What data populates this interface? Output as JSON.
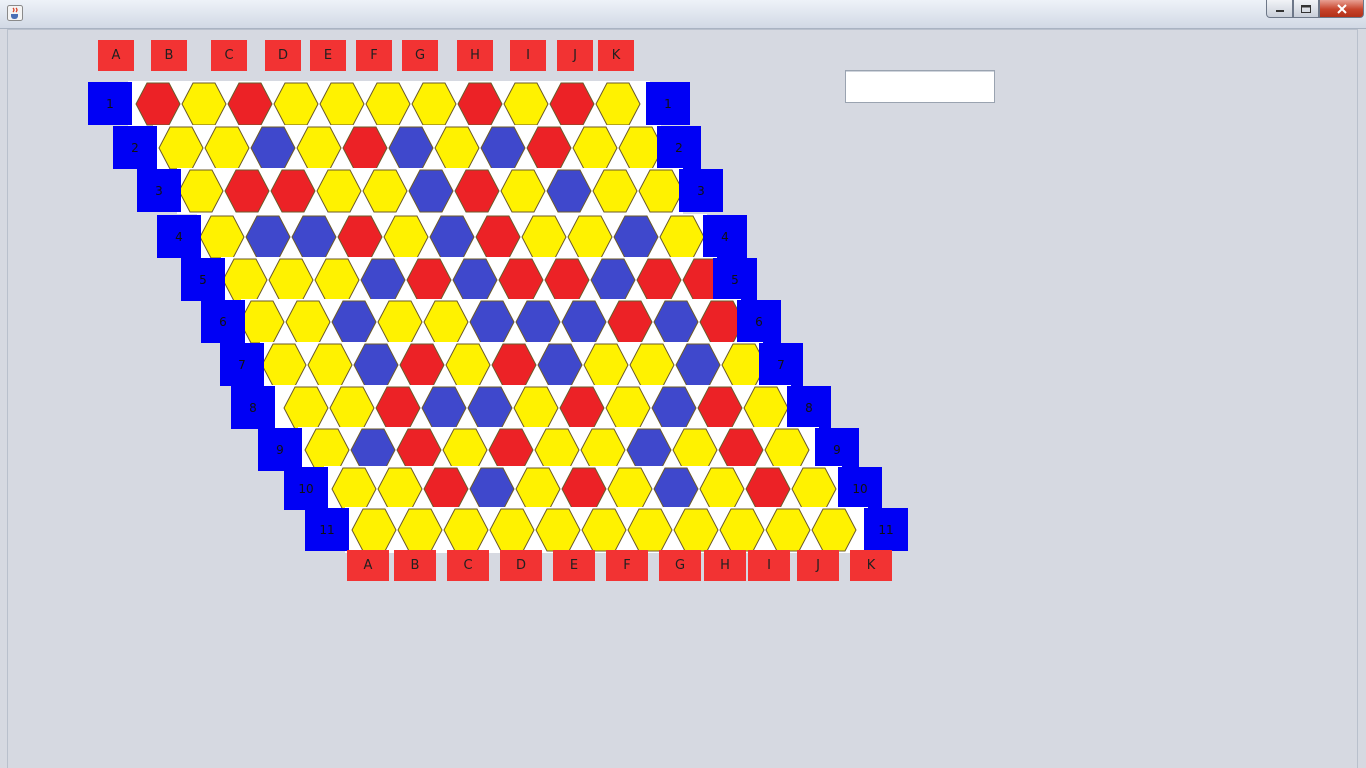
{
  "window": {
    "title": "",
    "icon": "java-coffee-icon",
    "controls": [
      "minimize-icon",
      "maximize-icon",
      "close-icon"
    ]
  },
  "colors": {
    "background": "#d6d9e1",
    "red": "#ec2226",
    "yellow": "#fff200",
    "blue": "#3f48cc",
    "border_blue": "#0000f5",
    "label_red": "#f23333"
  },
  "status_field": {
    "value": ""
  },
  "board": {
    "columns": [
      "A",
      "B",
      "C",
      "D",
      "E",
      "F",
      "G",
      "H",
      "I",
      "J",
      "K"
    ],
    "rows": [
      "1",
      "2",
      "3",
      "4",
      "5",
      "6",
      "7",
      "8",
      "9",
      "10",
      "11"
    ],
    "cells": [
      [
        "R",
        "Y",
        "R",
        "Y",
        "Y",
        "Y",
        "Y",
        "R",
        "Y",
        "R",
        "Y"
      ],
      [
        "Y",
        "Y",
        "B",
        "Y",
        "R",
        "B",
        "Y",
        "B",
        "R",
        "Y",
        "Y"
      ],
      [
        "Y",
        "R",
        "R",
        "Y",
        "Y",
        "B",
        "R",
        "Y",
        "B",
        "Y",
        "Y"
      ],
      [
        "Y",
        "B",
        "B",
        "R",
        "Y",
        "B",
        "R",
        "Y",
        "Y",
        "B",
        "Y"
      ],
      [
        "Y",
        "Y",
        "Y",
        "B",
        "R",
        "B",
        "R",
        "R",
        "B",
        "R",
        "R"
      ],
      [
        "Y",
        "Y",
        "B",
        "Y",
        "Y",
        "B",
        "B",
        "B",
        "R",
        "B",
        "R"
      ],
      [
        "Y",
        "Y",
        "B",
        "R",
        "Y",
        "R",
        "B",
        "Y",
        "Y",
        "B",
        "Y"
      ],
      [
        "Y",
        "Y",
        "R",
        "B",
        "B",
        "Y",
        "R",
        "Y",
        "B",
        "R",
        "Y"
      ],
      [
        "Y",
        "B",
        "R",
        "Y",
        "R",
        "Y",
        "Y",
        "B",
        "Y",
        "R",
        "Y"
      ],
      [
        "Y",
        "Y",
        "R",
        "B",
        "Y",
        "R",
        "Y",
        "B",
        "Y",
        "R",
        "Y"
      ],
      [
        "Y",
        "Y",
        "Y",
        "Y",
        "Y",
        "Y",
        "Y",
        "Y",
        "Y",
        "Y",
        "Y"
      ]
    ]
  }
}
